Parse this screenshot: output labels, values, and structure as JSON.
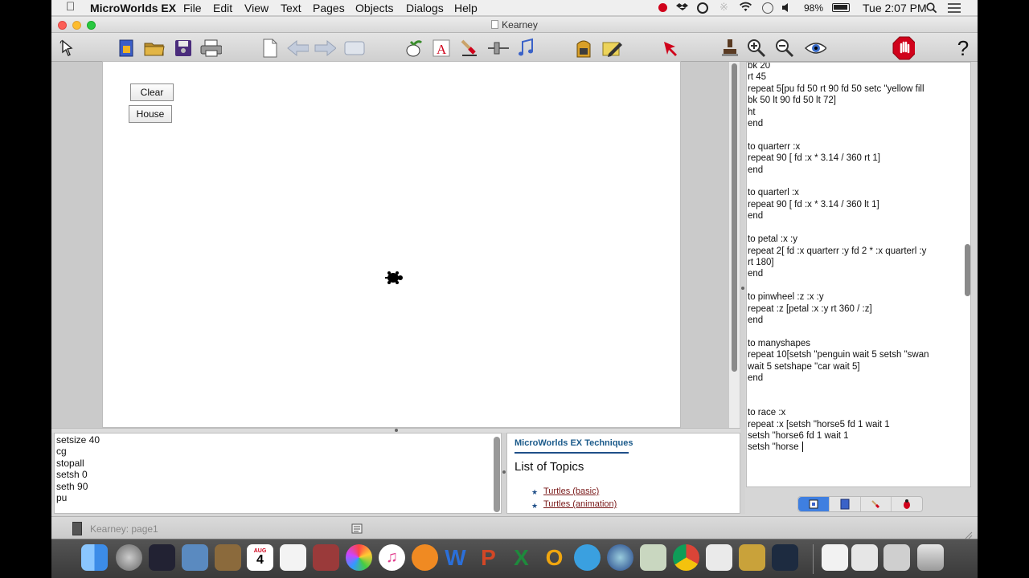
{
  "menubar": {
    "app_name": "MicroWorlds EX",
    "menus": [
      "File",
      "Edit",
      "View",
      "Text",
      "Pages",
      "Objects",
      "Dialogs",
      "Help"
    ],
    "battery": "98%",
    "clock": "Tue 2:07 PM"
  },
  "window": {
    "title": "Kearney"
  },
  "page": {
    "buttons": [
      "Clear",
      "House"
    ]
  },
  "command_center": {
    "lines": [
      "setsize 40",
      "cg",
      "stopall",
      "setsh 0",
      "seth 90",
      "pu"
    ]
  },
  "help": {
    "header": "MicroWorlds EX Techniques",
    "title": "List of Topics",
    "links": [
      "Turtles (basic)",
      "Turtles (animation)"
    ]
  },
  "procedures": {
    "text": "bk 20\nrt 45\nrepeat 5[pu fd 50 rt 90 fd 50 setc \"yellow fill\nbk 50 lt 90 fd 50 lt 72]\nht\nend\n\nto quarterr :x\nrepeat 90 [ fd :x * 3.14 / 360 rt 1]\nend\n\nto quarterl :x\nrepeat 90 [ fd :x * 3.14 / 360 lt 1]\nend\n\nto petal :x :y\nrepeat 2[ fd :x quarterr :y fd 2 * :x quarterl :y\nrt 180]\nend\n\nto pinwheel :z :x :y\nrepeat :z [petal :x :y rt 360 / :z]\nend\n\nto manyshapes\nrepeat 10[setsh \"penguin wait 5 setsh \"swan\nwait 5 setshape \"car wait 5]\nend\n\n\nto race :x\nrepeat :x [setsh \"horse5 fd 1 wait 1\nsetsh \"horse6 fd 1 wait 1\nsetsh \"horse"
  },
  "status": {
    "text": "Kearney: page1"
  },
  "dock": {
    "calendar_month": "AUG",
    "calendar_day": "4"
  }
}
